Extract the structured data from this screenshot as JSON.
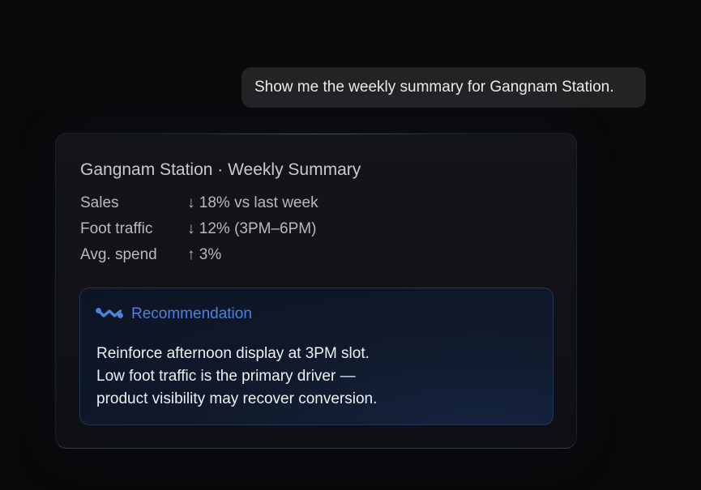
{
  "user_message": "Show me the weekly summary for Gangnam Station.",
  "summary_card": {
    "title": "Gangnam Station · Weekly Summary",
    "metrics": [
      {
        "label": "Sales",
        "value": "↓ 18% vs last week"
      },
      {
        "label": "Foot traffic",
        "value": "↓ 12% (3PM–6PM)"
      },
      {
        "label": "Avg. spend",
        "value": "↑ 3%"
      }
    ],
    "recommendation": {
      "icon": "wave-icon",
      "label": "Recommendation",
      "lines": [
        "Reinforce afternoon display at 3PM slot.",
        "Low foot traffic is the primary driver —",
        "product visibility may recover conversion."
      ]
    }
  },
  "colors": {
    "background": "#0a0a0a",
    "user_bubble": "#242426",
    "accent": "#4d82de"
  }
}
